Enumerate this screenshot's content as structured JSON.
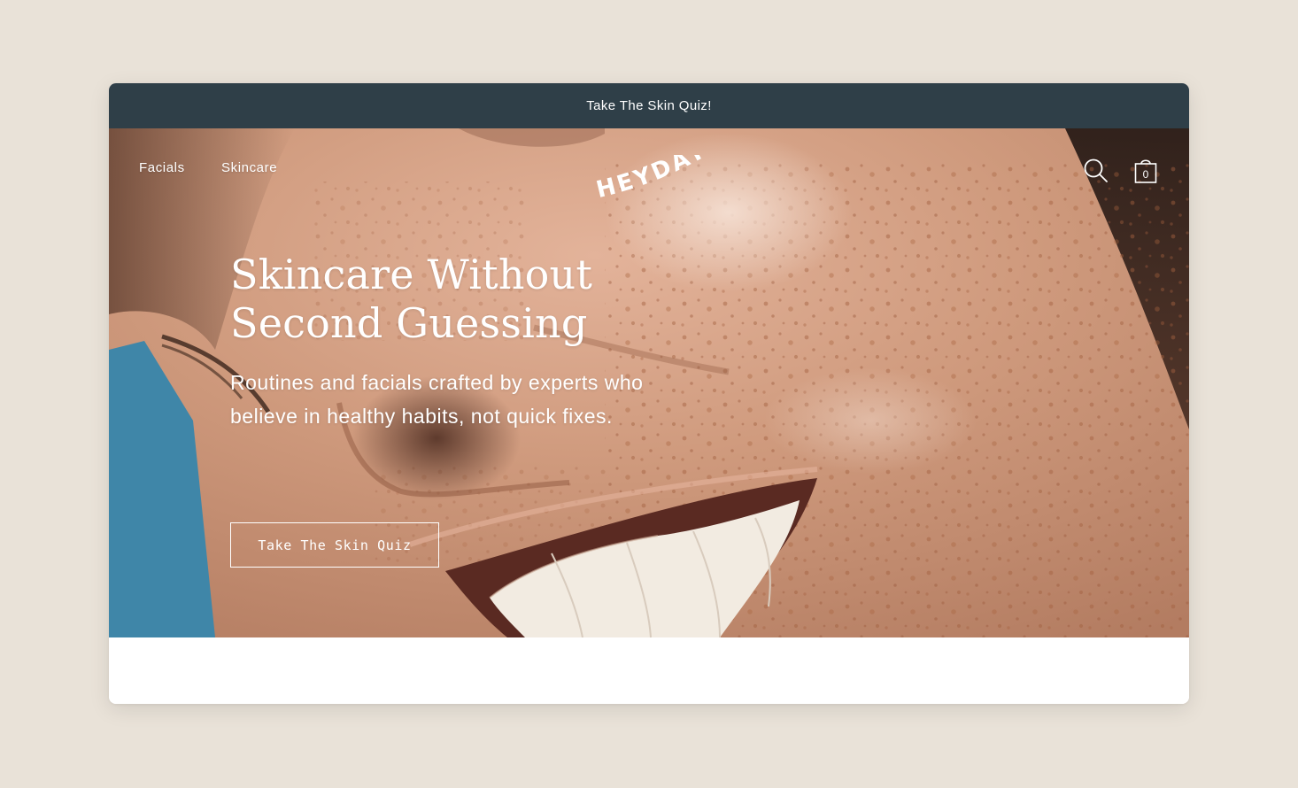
{
  "announcement": {
    "text": "Take The Skin Quiz!"
  },
  "nav": {
    "items": [
      {
        "label": "Facials"
      },
      {
        "label": "Skincare"
      }
    ],
    "logo_text": "HEYDAY",
    "search_icon": "search-icon",
    "cart_icon": "shopping-bag-icon",
    "cart_count": "0"
  },
  "hero": {
    "title_lines": [
      "Skincare Without",
      "Second Guessing"
    ],
    "subtitle_lines": [
      "Routines and facials crafted by experts who",
      "believe in healthy habits, not quick fixes."
    ],
    "cta_label": "Take The Skin Quiz"
  },
  "colors": {
    "page_background": "#e9e2d8",
    "announcement_bar": "#2f3f48",
    "hero_text": "#ffffff",
    "skin_tone": "#c58d6f",
    "accent_blue": "#3f86a8"
  }
}
